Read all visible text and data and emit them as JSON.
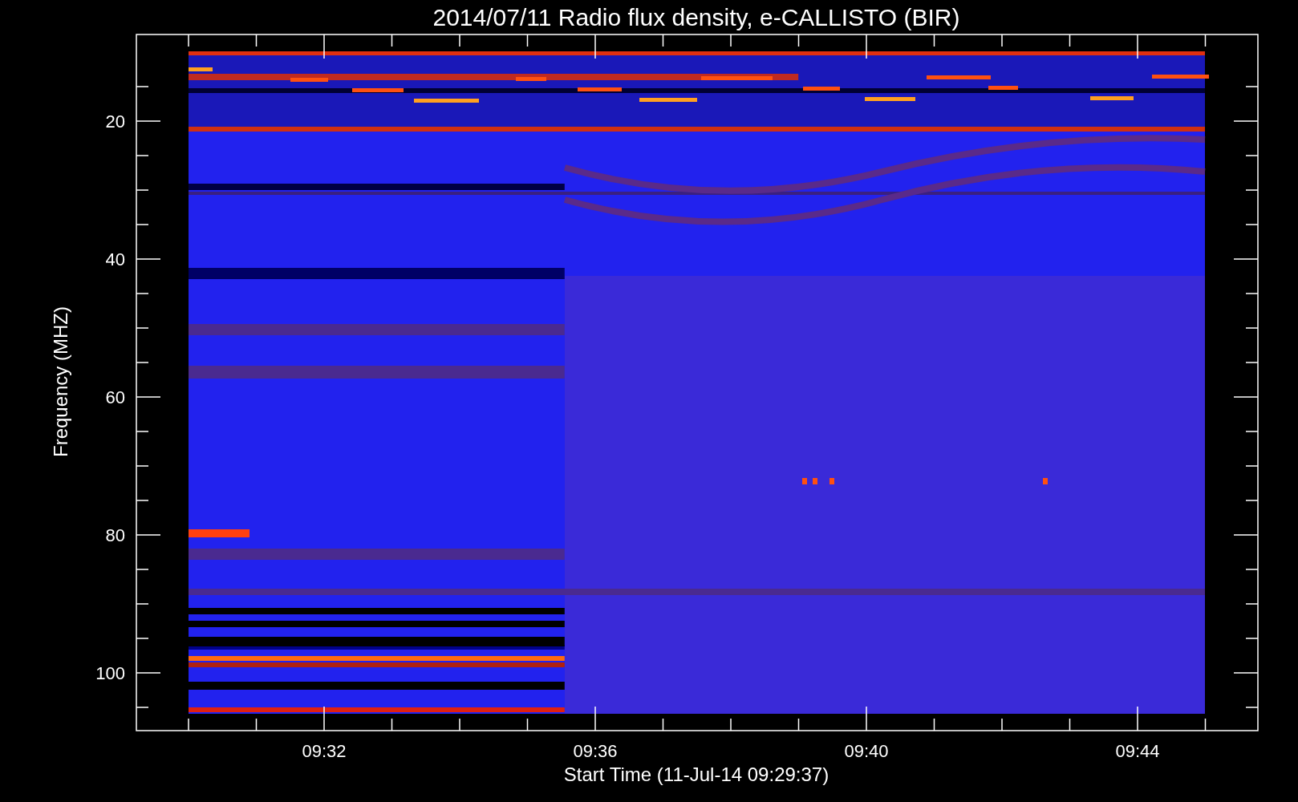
{
  "title": "2014/07/11  Radio flux density, e-CALLISTO (BIR)",
  "y_axis": {
    "label": "Frequency (MHZ)",
    "ticks": [
      "20",
      "40",
      "60",
      "80",
      "100"
    ]
  },
  "x_axis": {
    "label": "Start Time (11-Jul-14 09:29:37)",
    "ticks": [
      "09:32",
      "09:36",
      "09:40",
      "09:44"
    ]
  }
}
